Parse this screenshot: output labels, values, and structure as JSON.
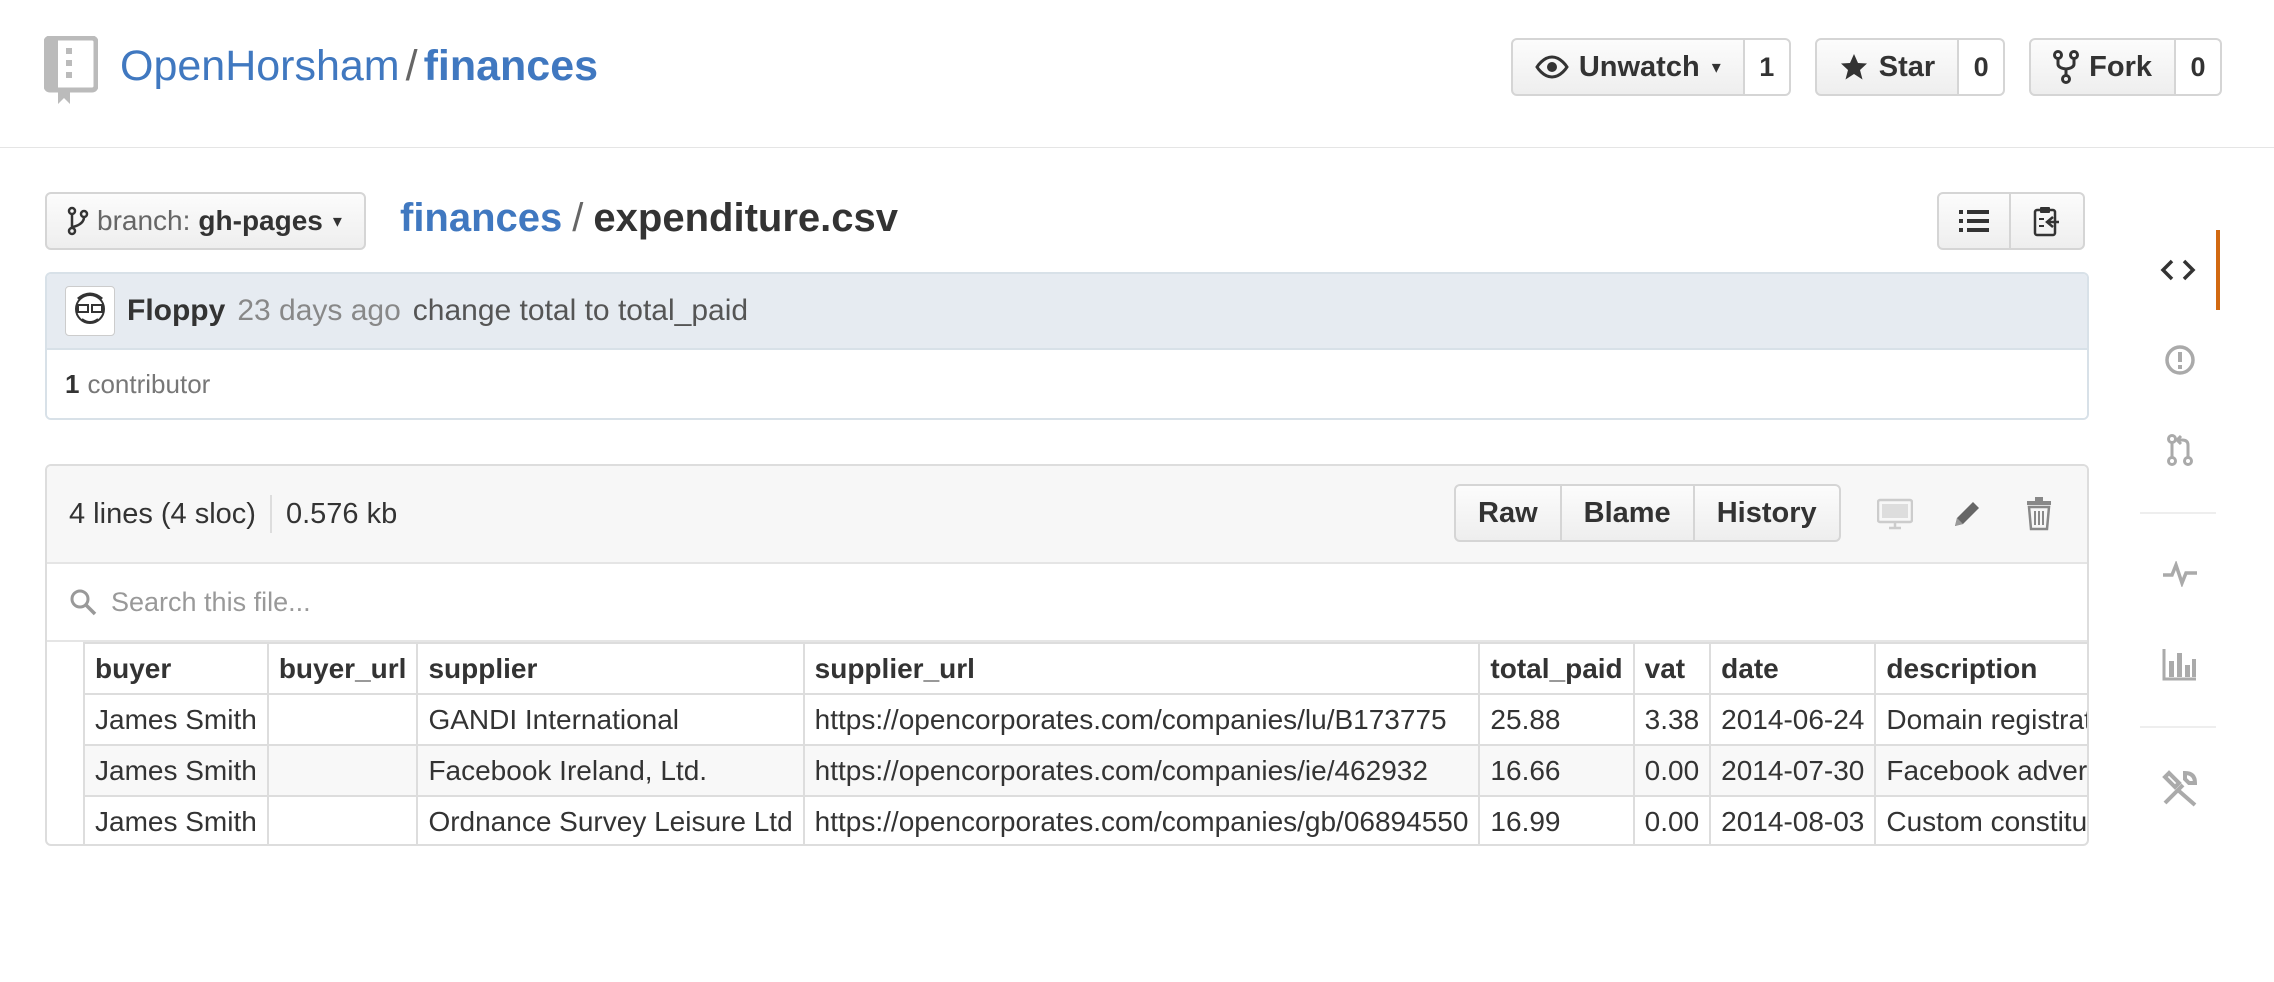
{
  "header": {
    "owner": "OpenHorsham",
    "separator": "/",
    "repo": "finances",
    "actions": [
      {
        "label": "Unwatch",
        "count": "1",
        "icon": "eye-icon"
      },
      {
        "label": "Star",
        "count": "0",
        "icon": "star-icon"
      },
      {
        "label": "Fork",
        "count": "0",
        "icon": "fork-icon"
      }
    ]
  },
  "branch": {
    "prefix": "branch:",
    "name": "gh-pages"
  },
  "breadcrumb": {
    "root": "finances",
    "separator": "/",
    "file": "expenditure.csv"
  },
  "commit": {
    "author": "Floppy",
    "time": "23 days ago",
    "message": "change total to total_paid",
    "contributor_count": "1",
    "contributor_label": "contributor"
  },
  "file": {
    "lines": "4 lines (4 sloc)",
    "size": "0.576 kb",
    "actions": [
      "Raw",
      "Blame",
      "History"
    ],
    "search_placeholder": "Search this file..."
  },
  "table": {
    "columns": [
      "buyer",
      "buyer_url",
      "supplier",
      "supplier_url",
      "total_paid",
      "vat",
      "date",
      "description"
    ],
    "rows": [
      [
        "James Smith",
        "",
        "GANDI International",
        "https://opencorporates.com/companies/lu/B173775",
        "25.88",
        "3.38",
        "2014-06-24",
        "Domain registration"
      ],
      [
        "James Smith",
        "",
        "Facebook Ireland, Ltd.",
        "https://opencorporates.com/companies/ie/462932",
        "16.66",
        "0.00",
        "2014-07-30",
        "Facebook advertising"
      ],
      [
        "James Smith",
        "",
        "Ordnance Survey Leisure Ltd",
        "https://opencorporates.com/companies/gb/06894550",
        "16.99",
        "0.00",
        "2014-08-03",
        "Custom constituency"
      ]
    ]
  },
  "sidebar": {
    "items": [
      "code-icon",
      "issues-icon",
      "pull-request-icon",
      "pulse-icon",
      "graphs-icon",
      "settings-icon"
    ],
    "accent": "#d26911"
  }
}
